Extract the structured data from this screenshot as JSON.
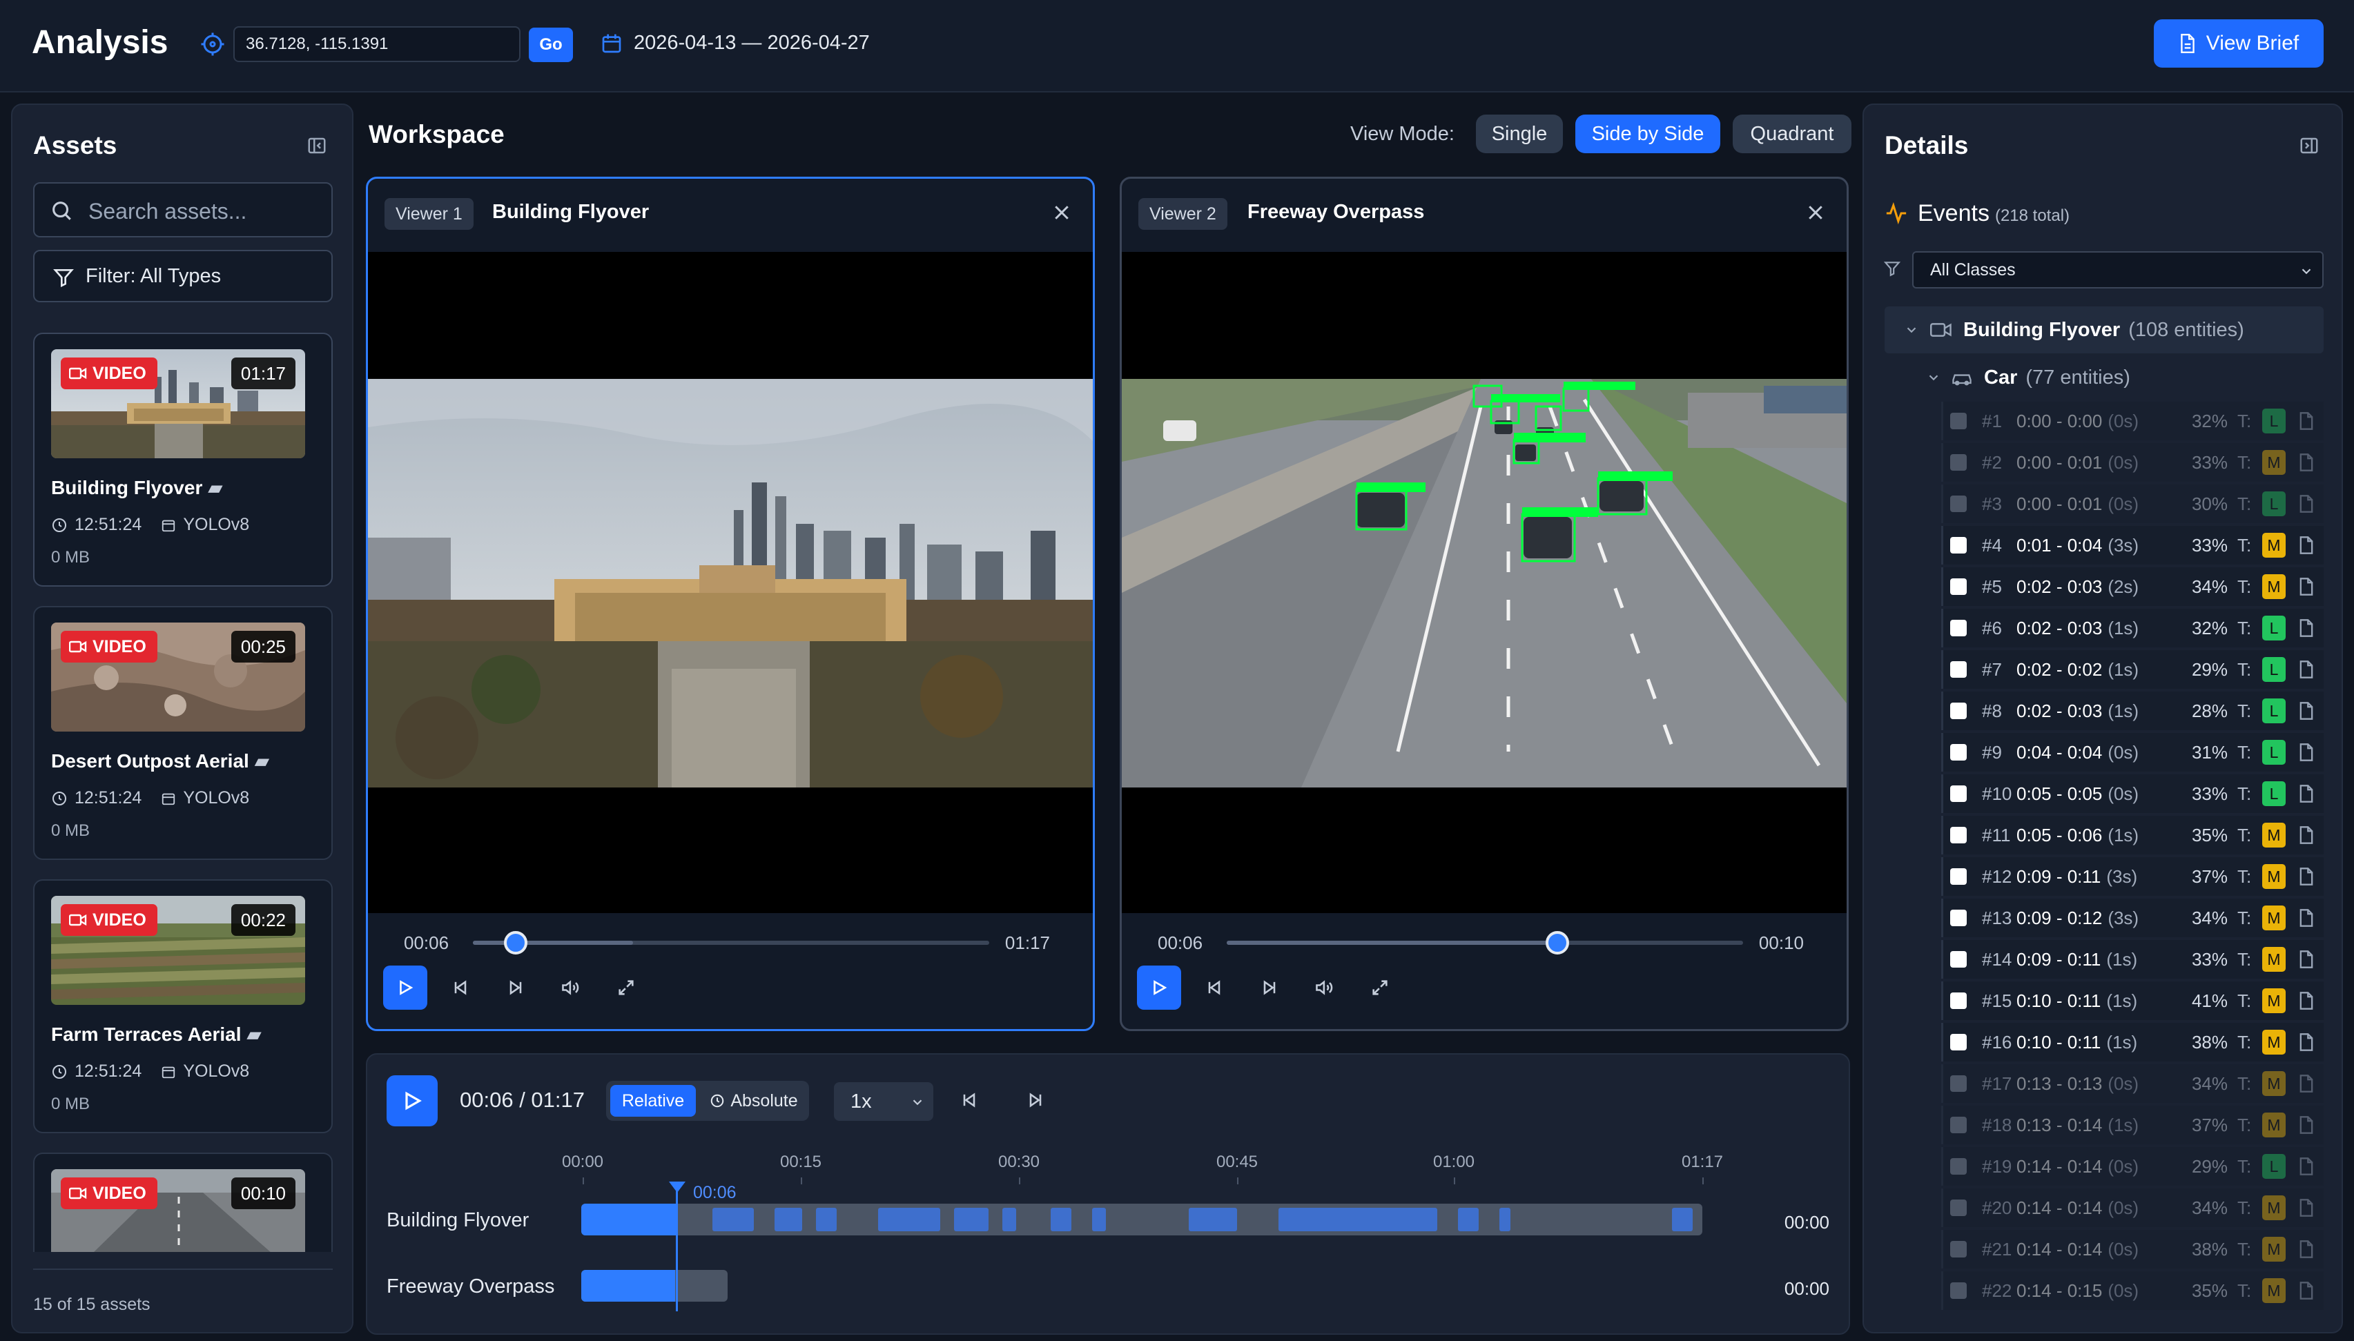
{
  "header": {
    "title": "Analysis",
    "coords_value": "36.7128, -115.1391",
    "go_label": "Go",
    "date_range": "2026-04-13 — 2026-04-27",
    "brief_label": "View Brief"
  },
  "assets": {
    "title": "Assets",
    "search_placeholder": "Search assets...",
    "filter_label": "Filter: All Types",
    "items": [
      {
        "badge": "VIDEO",
        "duration": "01:17",
        "name": "Building Flyover",
        "time": "12:51:24",
        "model": "YOLOv8",
        "size": "0 MB"
      },
      {
        "badge": "VIDEO",
        "duration": "00:25",
        "name": "Desert Outpost Aerial",
        "time": "12:51:24",
        "model": "YOLOv8",
        "size": "0 MB"
      },
      {
        "badge": "VIDEO",
        "duration": "00:22",
        "name": "Farm Terraces Aerial",
        "time": "12:51:24",
        "model": "YOLOv8",
        "size": "0 MB"
      },
      {
        "badge": "VIDEO",
        "duration": "00:10"
      }
    ],
    "count": "15 of 15 assets"
  },
  "workspace": {
    "title": "Workspace",
    "view_mode_label": "View Mode:",
    "modes": [
      "Single",
      "Side by Side",
      "Quadrant"
    ],
    "active_mode": "Side by Side",
    "viewers": [
      {
        "tag": "Viewer 1",
        "name": "Building Flyover",
        "current": "00:06",
        "total": "01:17",
        "progress": 0.083
      },
      {
        "tag": "Viewer 2",
        "name": "Freeway Overpass",
        "current": "00:06",
        "total": "00:10",
        "progress": 0.64
      }
    ]
  },
  "timeline": {
    "time": "00:06 / 01:17",
    "relative_label": "Relative",
    "absolute_label": "Absolute",
    "speed": "1x",
    "ticks": [
      "00:00",
      "00:15",
      "00:30",
      "00:45",
      "01:00",
      "01:17"
    ],
    "playhead": "00:06",
    "tracks": [
      {
        "name": "Building Flyover",
        "end": "00:00"
      },
      {
        "name": "Freeway Overpass",
        "end": "00:00"
      }
    ]
  },
  "details": {
    "title": "Details",
    "events_label": "Events",
    "events_count": "(218 total)",
    "class_filter": "All Classes",
    "group": {
      "name": "Building Flyover",
      "count": "(108 entities)"
    },
    "subgroup": {
      "name": "Car",
      "count": "(77 entities)"
    },
    "events": [
      {
        "id": "#1",
        "span": "0:00 - 0:00",
        "dur": "(0s)",
        "pct": "32%",
        "lvl": "L",
        "dim": true
      },
      {
        "id": "#2",
        "span": "0:00 - 0:01",
        "dur": "(0s)",
        "pct": "33%",
        "lvl": "M",
        "dim": true
      },
      {
        "id": "#3",
        "span": "0:00 - 0:01",
        "dur": "(0s)",
        "pct": "30%",
        "lvl": "L",
        "dim": true
      },
      {
        "id": "#4",
        "span": "0:01 - 0:04",
        "dur": "(3s)",
        "pct": "33%",
        "lvl": "M",
        "dim": false
      },
      {
        "id": "#5",
        "span": "0:02 - 0:03",
        "dur": "(2s)",
        "pct": "34%",
        "lvl": "M",
        "dim": false
      },
      {
        "id": "#6",
        "span": "0:02 - 0:03",
        "dur": "(1s)",
        "pct": "32%",
        "lvl": "L",
        "dim": false
      },
      {
        "id": "#7",
        "span": "0:02 - 0:02",
        "dur": "(1s)",
        "pct": "29%",
        "lvl": "L",
        "dim": false
      },
      {
        "id": "#8",
        "span": "0:02 - 0:03",
        "dur": "(1s)",
        "pct": "28%",
        "lvl": "L",
        "dim": false
      },
      {
        "id": "#9",
        "span": "0:04 - 0:04",
        "dur": "(0s)",
        "pct": "31%",
        "lvl": "L",
        "dim": false
      },
      {
        "id": "#10",
        "span": "0:05 - 0:05",
        "dur": "(0s)",
        "pct": "33%",
        "lvl": "L",
        "dim": false
      },
      {
        "id": "#11",
        "span": "0:05 - 0:06",
        "dur": "(1s)",
        "pct": "35%",
        "lvl": "M",
        "dim": false
      },
      {
        "id": "#12",
        "span": "0:09 - 0:11",
        "dur": "(3s)",
        "pct": "37%",
        "lvl": "M",
        "dim": false
      },
      {
        "id": "#13",
        "span": "0:09 - 0:12",
        "dur": "(3s)",
        "pct": "34%",
        "lvl": "M",
        "dim": false
      },
      {
        "id": "#14",
        "span": "0:09 - 0:11",
        "dur": "(1s)",
        "pct": "33%",
        "lvl": "M",
        "dim": false
      },
      {
        "id": "#15",
        "span": "0:10 - 0:11",
        "dur": "(1s)",
        "pct": "41%",
        "lvl": "M",
        "dim": false
      },
      {
        "id": "#16",
        "span": "0:10 - 0:11",
        "dur": "(1s)",
        "pct": "38%",
        "lvl": "M",
        "dim": false
      },
      {
        "id": "#17",
        "span": "0:13 - 0:13",
        "dur": "(0s)",
        "pct": "34%",
        "lvl": "M",
        "dim": true
      },
      {
        "id": "#18",
        "span": "0:13 - 0:14",
        "dur": "(1s)",
        "pct": "37%",
        "lvl": "M",
        "dim": true
      },
      {
        "id": "#19",
        "span": "0:14 - 0:14",
        "dur": "(0s)",
        "pct": "29%",
        "lvl": "L",
        "dim": true
      },
      {
        "id": "#20",
        "span": "0:14 - 0:14",
        "dur": "(0s)",
        "pct": "34%",
        "lvl": "M",
        "dim": true
      },
      {
        "id": "#21",
        "span": "0:14 - 0:14",
        "dur": "(0s)",
        "pct": "38%",
        "lvl": "M",
        "dim": true
      },
      {
        "id": "#22",
        "span": "0:14 - 0:15",
        "dur": "(0s)",
        "pct": "35%",
        "lvl": "M",
        "dim": true
      }
    ],
    "level_prefix": "T:"
  },
  "colors": {
    "accent": "#1f6bff",
    "level_L": "#22c55e",
    "level_M": "#eab308",
    "video_badge": "#e3272f",
    "detection_box": "#00ff3c"
  }
}
